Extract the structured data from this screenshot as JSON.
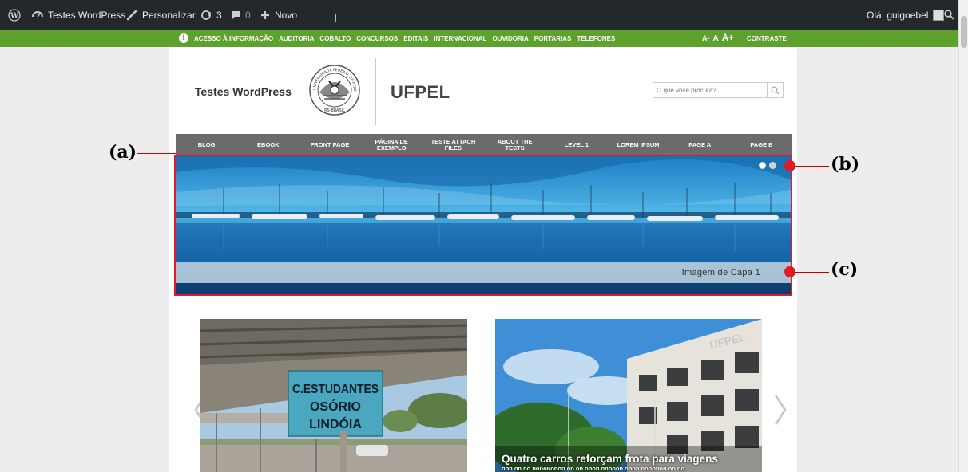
{
  "admin_bar": {
    "site_name": "Testes WordPress",
    "customize": "Personalizar",
    "updates_count": "3",
    "comments_count": "0",
    "new_label": "Novo",
    "greeting": "Olá, guigoebel"
  },
  "gov_bar": {
    "links": [
      "ACESSO À INFORMAÇÃO",
      "AUDITORIA",
      "COBALTO",
      "CONCURSOS",
      "EDITAIS",
      "INTERNACIONAL",
      "OUVIDORIA",
      "PORTARIAS",
      "TELEFONES"
    ],
    "font_small": "A-",
    "font_normal": "A",
    "font_large": "A+",
    "contrast": "CONTRASTE"
  },
  "header": {
    "site_title": "Testes WordPress",
    "brand": "UFPEL",
    "seal_text": "UNIVERSIDADE FEDERAL DE PELOTAS · RS-BRASIL",
    "search_placeholder": "O que você procura?"
  },
  "nav": {
    "items": [
      "BLOG",
      "EBOOK",
      "FRONT PAGE",
      "PÁGINA DE EXEMPLO",
      "TESTE ATTACH FILES",
      "ABOUT THE TESTS",
      "LEVEL 1",
      "LOREM IPSUM",
      "PAGE A",
      "PAGE B"
    ]
  },
  "slider": {
    "caption": "Imagem de Capa 1",
    "active_slide": 1,
    "slide_count": 2
  },
  "annotations": {
    "a": "(a)",
    "b": "(b)",
    "c": "(c)"
  },
  "news": {
    "card1_sign": [
      "C.ESTUDANTES",
      "OSÓRIO",
      "LINDÓIA"
    ],
    "card2_building_sign": "UFPEL",
    "card2_title": "Quatro carros reforçam frota para viagens",
    "card2_excerpt": "non on no nonononon on on onon onooon onon nononon on no",
    "prev_arrow": "〈",
    "next_arrow": "〉"
  },
  "colors": {
    "admin_bg": "#23282d",
    "gov_green": "#5ca22d",
    "nav_gray": "#6b6b6b",
    "callout_red": "#e01b24"
  }
}
